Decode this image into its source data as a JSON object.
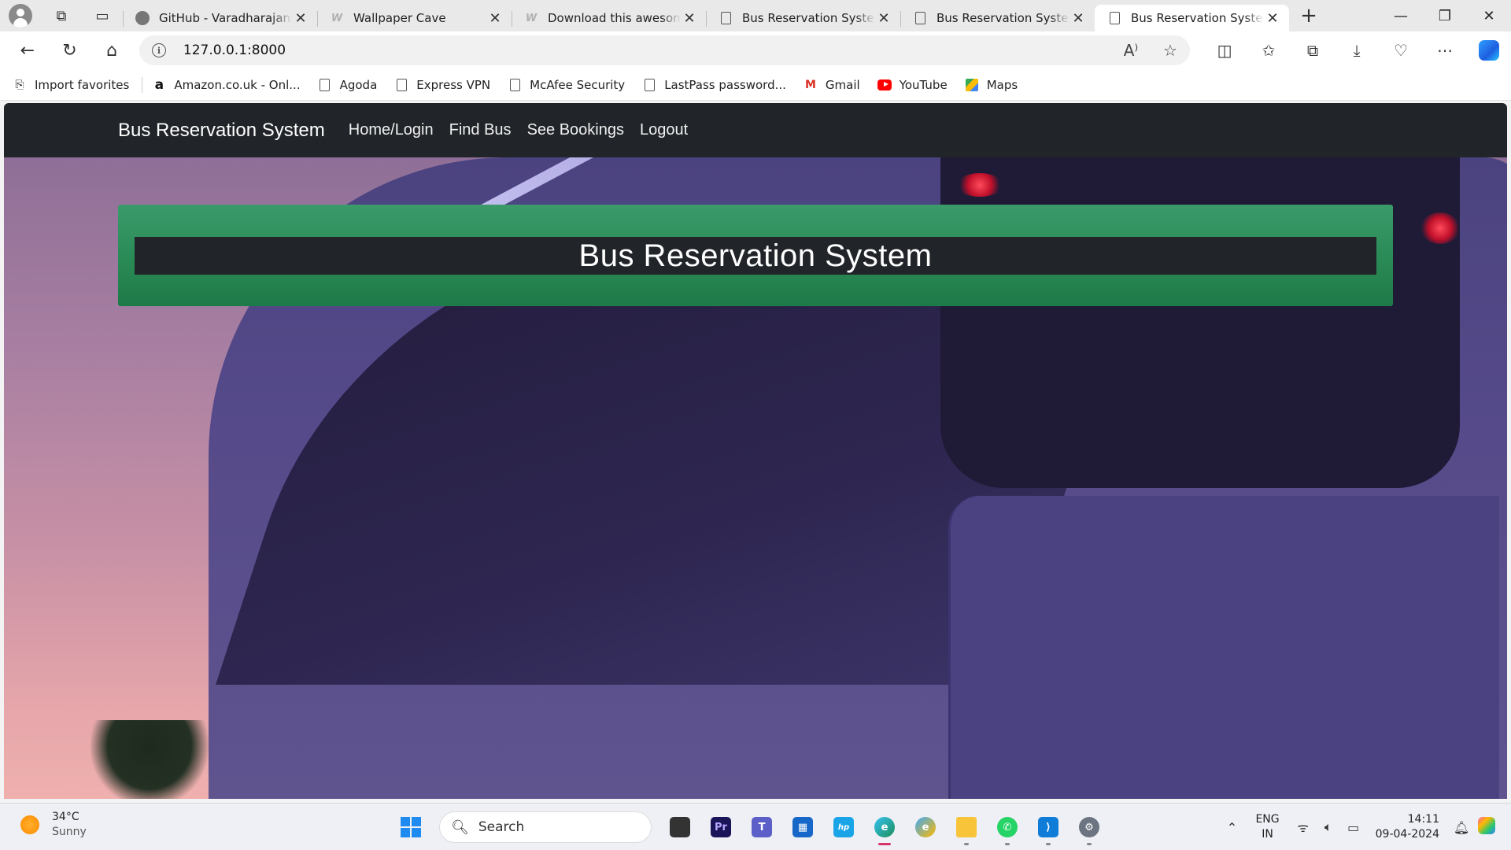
{
  "browser": {
    "tabs": [
      {
        "title": "GitHub - VaradharajanPro",
        "favicon": "github-icon",
        "active": false
      },
      {
        "title": "Wallpaper Cave",
        "favicon": "wallpapercave-icon",
        "active": false
      },
      {
        "title": "Download this awesome",
        "favicon": "wallpapercave-icon",
        "active": false
      },
      {
        "title": "Bus Reservation System in",
        "favicon": "page-icon",
        "active": false
      },
      {
        "title": "Bus Reservation System in",
        "favicon": "page-icon",
        "active": false
      },
      {
        "title": "Bus Reservation System in",
        "favicon": "page-icon",
        "active": true
      }
    ],
    "address": {
      "url": "127.0.0.1:8000"
    },
    "favorites": [
      {
        "label": "Import favorites",
        "icon": "import-icon"
      },
      {
        "label": "Amazon.co.uk - Onl...",
        "icon": "amazon-icon"
      },
      {
        "label": "Agoda",
        "icon": "page-icon"
      },
      {
        "label": "Express VPN",
        "icon": "page-icon"
      },
      {
        "label": "McAfee Security",
        "icon": "page-icon"
      },
      {
        "label": "LastPass password...",
        "icon": "page-icon"
      },
      {
        "label": "Gmail",
        "icon": "gmail-icon"
      },
      {
        "label": "YouTube",
        "icon": "youtube-icon"
      },
      {
        "label": "Maps",
        "icon": "maps-icon"
      }
    ]
  },
  "page": {
    "navbar": {
      "brand": "Bus Reservation System",
      "links": [
        "Home/Login",
        "Find Bus",
        "See Bookings",
        "Logout"
      ]
    },
    "banner": {
      "title": "Bus Reservation System"
    },
    "colors": {
      "navbar": "#212529",
      "banner_green": "#2a8a56",
      "banner_inner": "#212529"
    }
  },
  "taskbar": {
    "weather": {
      "temp": "34°C",
      "condition": "Sunny"
    },
    "search_placeholder": "Search",
    "language": {
      "line1": "ENG",
      "line2": "IN"
    },
    "clock": {
      "time": "14:11",
      "date": "09-04-2024"
    }
  }
}
